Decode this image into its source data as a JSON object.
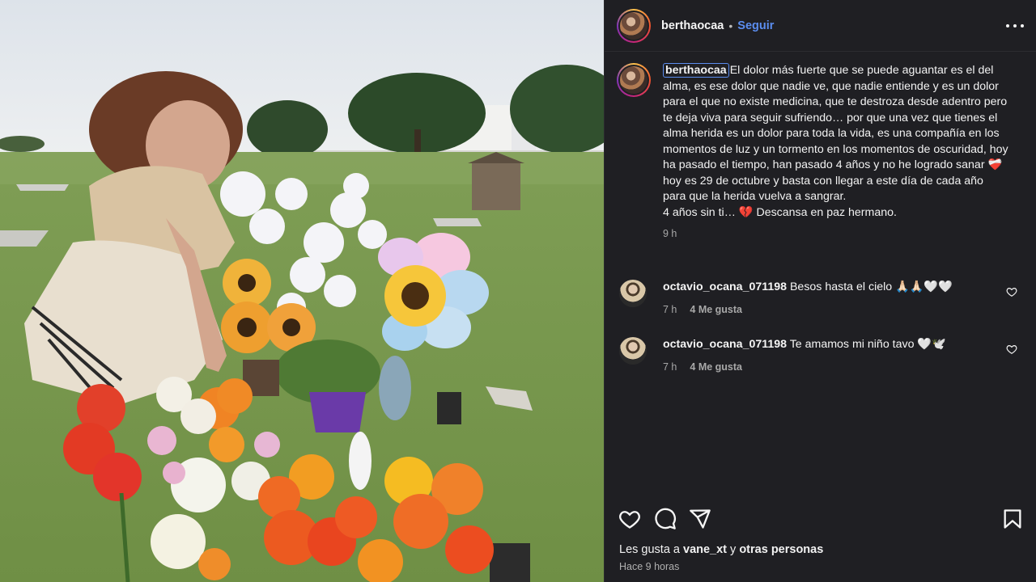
{
  "post": {
    "username": "berthaocaa",
    "separator": "•",
    "follow_label": "Seguir"
  },
  "caption": {
    "username": "berthaocaa",
    "text": "El dolor más fuerte que se puede aguantar es el del alma, es ese dolor que nadie ve, que nadie entiende y es un dolor para el que no existe medicina, que te destroza desde adentro pero te deja viva para seguir sufriendo… por que una vez que tienes el alma herida es un dolor para toda la vida, es una compañía en los momentos de luz y un tormento en los momentos de oscuridad, hoy ha pasado el tiempo, han pasado 4 años y no he logrado sanar ❤️‍🩹 hoy es 29 de octubre y basta con llegar a este día de cada año para que la herida vuelva a sangrar.\n4 años sin ti… 💔 Descansa en paz hermano.",
    "time": "9 h"
  },
  "comments": [
    {
      "username": "octavio_ocana_071198",
      "text": "Besos hasta el cielo 🙏🏻🙏🏻🤍🤍",
      "time": "7 h",
      "likes": "4 Me gusta"
    },
    {
      "username": "octavio_ocana_071198",
      "text": "Te amamos mi niño tavo 🤍🕊️",
      "time": "7 h",
      "likes": "4 Me gusta"
    }
  ],
  "footer": {
    "likes_prefix": "Les gusta a ",
    "likes_user": "vane_xt",
    "likes_middle": " y ",
    "likes_rest": "otras personas",
    "time_ago": "Hace 9 horas"
  },
  "icons": {
    "more": "more-options-icon",
    "like": "heart-icon",
    "comment": "comment-icon",
    "share": "share-icon",
    "save": "bookmark-icon"
  },
  "colors": {
    "panel_bg": "#1f1f23",
    "follow": "#5b8def"
  }
}
